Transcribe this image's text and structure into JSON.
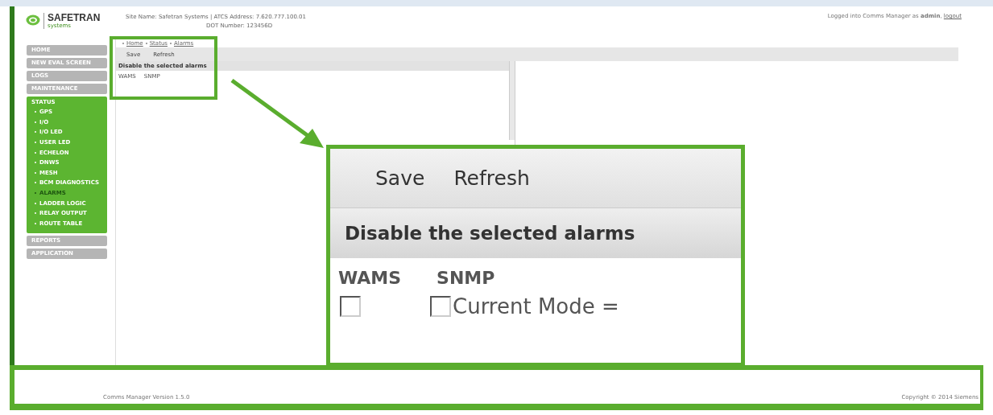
{
  "header": {
    "logo": "SAFETRAN",
    "logo_sub": "systems",
    "site_info": "Site Name: Safetran Systems | ATCS Address: 7.620.777.100.01",
    "site_info_2": "DOT Number: 123456D",
    "login_text": "Logged into Comms Manager as **admin**,",
    "logout": "logout"
  },
  "sidebar": {
    "items": [
      {
        "label": "HOME"
      },
      {
        "label": "NEW EVAL SCREEN"
      },
      {
        "label": "LOGS"
      },
      {
        "label": "MAINTENANCE"
      },
      {
        "label": "STATUS",
        "expanded": true,
        "children": [
          {
            "label": "GPS",
            "selected": false
          },
          {
            "label": "I/O",
            "selected": false
          },
          {
            "label": "I/O LED",
            "selected": false
          },
          {
            "label": "USER LED",
            "selected": false
          },
          {
            "label": "ECHELON",
            "selected": false
          },
          {
            "label": "DNWS",
            "selected": false
          },
          {
            "label": "MESH",
            "selected": false
          },
          {
            "label": "BCM DIAGNOSTICS",
            "selected": false
          },
          {
            "label": "ALARMS",
            "selected": true
          },
          {
            "label": "LADDER LOGIC",
            "selected": false
          },
          {
            "label": "RELAY OUTPUT",
            "selected": false
          },
          {
            "label": "ROUTE TABLE",
            "selected": false
          }
        ]
      },
      {
        "label": "REPORTS"
      },
      {
        "label": "APPLICATION"
      }
    ]
  },
  "breadcrumb": [
    "Home",
    "Status",
    "Alarms"
  ],
  "toolbar": [
    "Save",
    "Refresh"
  ],
  "section_title": "Disable the selected alarms",
  "columns": [
    "WAMS",
    "SNMP"
  ],
  "callout": {
    "toolbar": [
      "Save",
      "Refresh"
    ],
    "section_title": "Disable the selected alarms",
    "columns": [
      "WAMS",
      "SNMP"
    ],
    "checkboxes": [
      {
        "checked": false
      },
      {
        "checked": false
      }
    ],
    "mode_label": "Current Mode ="
  },
  "footer": {
    "version": "Comms Manager Version 1.5.0",
    "copyright": "Copyright © 2014 Siemens"
  }
}
